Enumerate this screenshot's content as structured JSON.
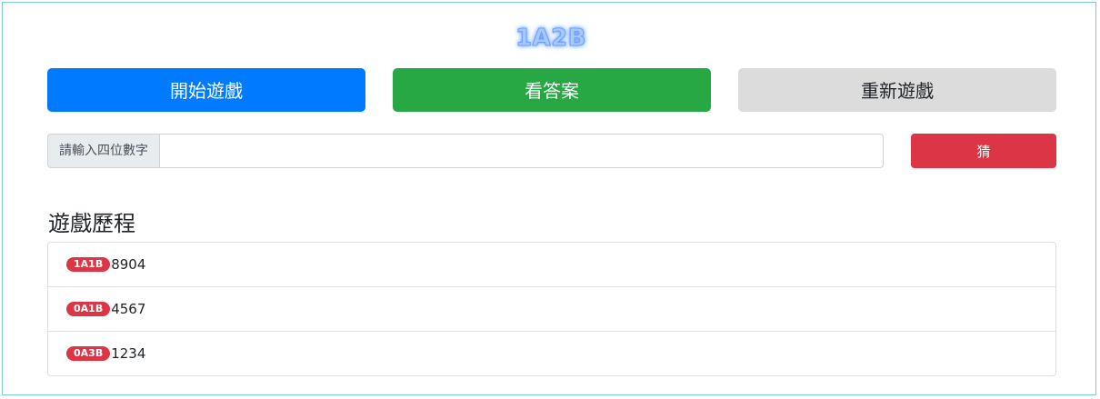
{
  "title": "1A2B",
  "buttons": {
    "start": "開始遊戲",
    "answer": "看答案",
    "restart": "重新遊戲",
    "guess": "猜"
  },
  "guess_input": {
    "label": "請輸入四位數字",
    "value": "",
    "placeholder": ""
  },
  "history": {
    "heading": "遊戲歷程",
    "items": [
      {
        "result": "1A1B",
        "number": "8904"
      },
      {
        "result": "0A1B",
        "number": "4567"
      },
      {
        "result": "0A3B",
        "number": "1234"
      }
    ]
  },
  "colors": {
    "start": "#007bff",
    "answer": "#28a745",
    "restart": "#dcdcdc",
    "guess": "#dc3545",
    "badge": "#dc3545"
  }
}
